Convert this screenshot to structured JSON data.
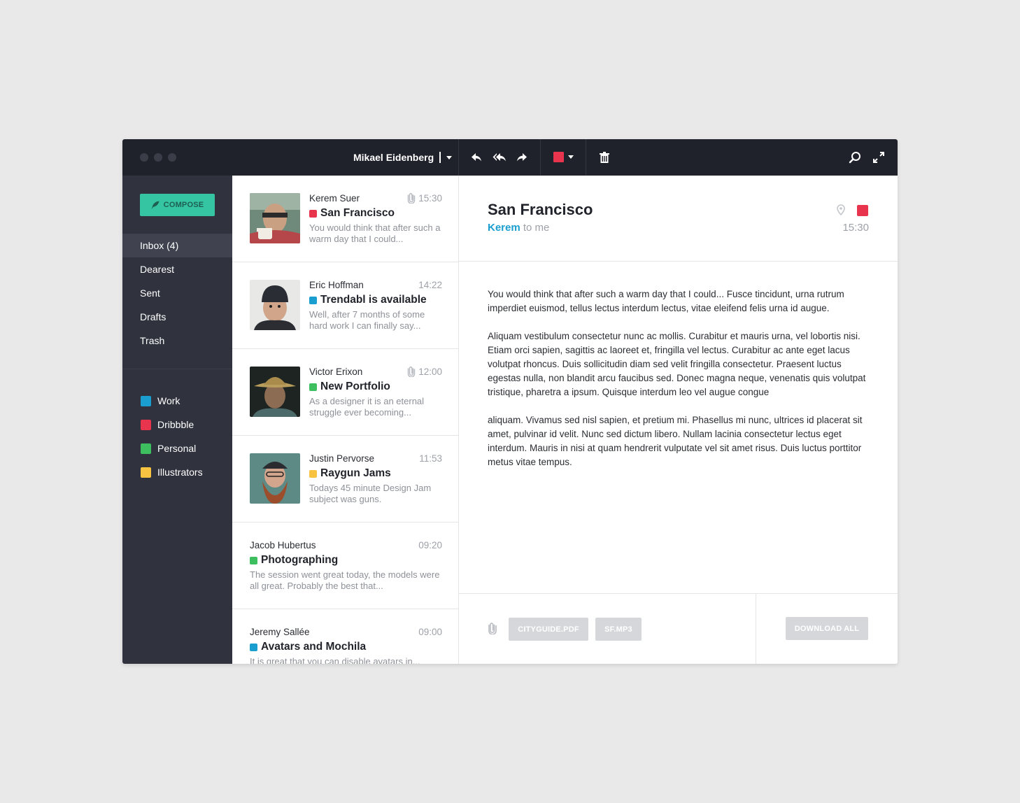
{
  "topbar": {
    "account_name": "Mikael Eidenberg",
    "icons": [
      "reply-icon",
      "reply-all-icon",
      "forward-icon",
      "flag-color-icon",
      "trash-icon",
      "search-icon",
      "fullscreen-icon"
    ],
    "flag_color": "#e8344d"
  },
  "sidebar": {
    "compose_label": "COMPOSE",
    "nav": [
      {
        "label": "Inbox (4)",
        "active": true
      },
      {
        "label": "Dearest"
      },
      {
        "label": "Sent"
      },
      {
        "label": "Drafts"
      },
      {
        "label": "Trash"
      }
    ],
    "labels": [
      {
        "label": "Work",
        "color": "#1a9ed0"
      },
      {
        "label": "Dribbble",
        "color": "#e8344d"
      },
      {
        "label": "Personal",
        "color": "#3dbf5f"
      },
      {
        "label": "Illustrators",
        "color": "#f7c341"
      }
    ]
  },
  "messages": [
    {
      "sender": "Kerem Suer",
      "time": "15:30",
      "attachment": true,
      "subject": "San Francisco",
      "color": "#e8344d",
      "preview": "You would think that after such a warm day that I could..."
    },
    {
      "sender": "Eric Hoffman",
      "time": "14:22",
      "attachment": false,
      "subject": "Trendabl is available",
      "color": "#1a9ed0",
      "preview": "Well, after 7 months of some hard work I can finally say..."
    },
    {
      "sender": "Victor Erixon",
      "time": "12:00",
      "attachment": true,
      "subject": "New Portfolio",
      "color": "#3dbf5f",
      "preview": "As a designer it is an eternal struggle ever becoming..."
    },
    {
      "sender": "Justin Pervorse",
      "time": "11:53",
      "attachment": false,
      "subject": "Raygun Jams",
      "color": "#f7c341",
      "preview": "Todays 45 minute Design Jam subject was guns."
    },
    {
      "sender": "Jacob Hubertus",
      "time": "09:20",
      "attachment": false,
      "subject": "Photographing",
      "color": "#3dbf5f",
      "preview": "The session went great today, the models were all great. Probably the best that..."
    },
    {
      "sender": "Jeremy Sallée",
      "time": "09:00",
      "attachment": false,
      "subject": "Avatars and Mochila",
      "color": "#1a9ed0",
      "preview": "It is great that you can disable avatars in..."
    }
  ],
  "reader": {
    "title": "San Francisco",
    "from_name": "Kerem",
    "from_suffix": "to me",
    "time": "15:30",
    "flag_color": "#e8344d",
    "paragraphs": [
      "You would think that after such a warm day that I could... Fusce tincidunt, urna rutrum imperdiet euismod, tellus lectus interdum lectus, vitae eleifend felis urna id augue.",
      "Aliquam vestibulum consectetur nunc ac mollis. Curabitur et mauris urna, vel lobortis nisi. Etiam orci sapien, sagittis ac laoreet et, fringilla vel lectus. Curabitur ac ante eget lacus volutpat rhoncus. Duis sollicitudin diam sed velit fringilla consectetur. Praesent luctus egestas nulla, non blandit arcu faucibus sed. Donec magna neque, venenatis quis volutpat tristique, pharetra a ipsum. Quisque interdum leo vel augue congue",
      "aliquam. Vivamus sed nisl sapien, et pretium mi. Phasellus mi nunc, ultrices id placerat sit amet, pulvinar id velit. Nunc sed dictum libero. Nullam lacinia consectetur lectus eget interdum. Mauris in nisi at quam hendrerit vulputate vel sit amet risus. Duis luctus porttitor metus vitae tempus."
    ],
    "attachments": [
      "CITYGUIDE.PDF",
      "SF.MP3"
    ],
    "download_all": "DOWNLOAD ALL"
  }
}
